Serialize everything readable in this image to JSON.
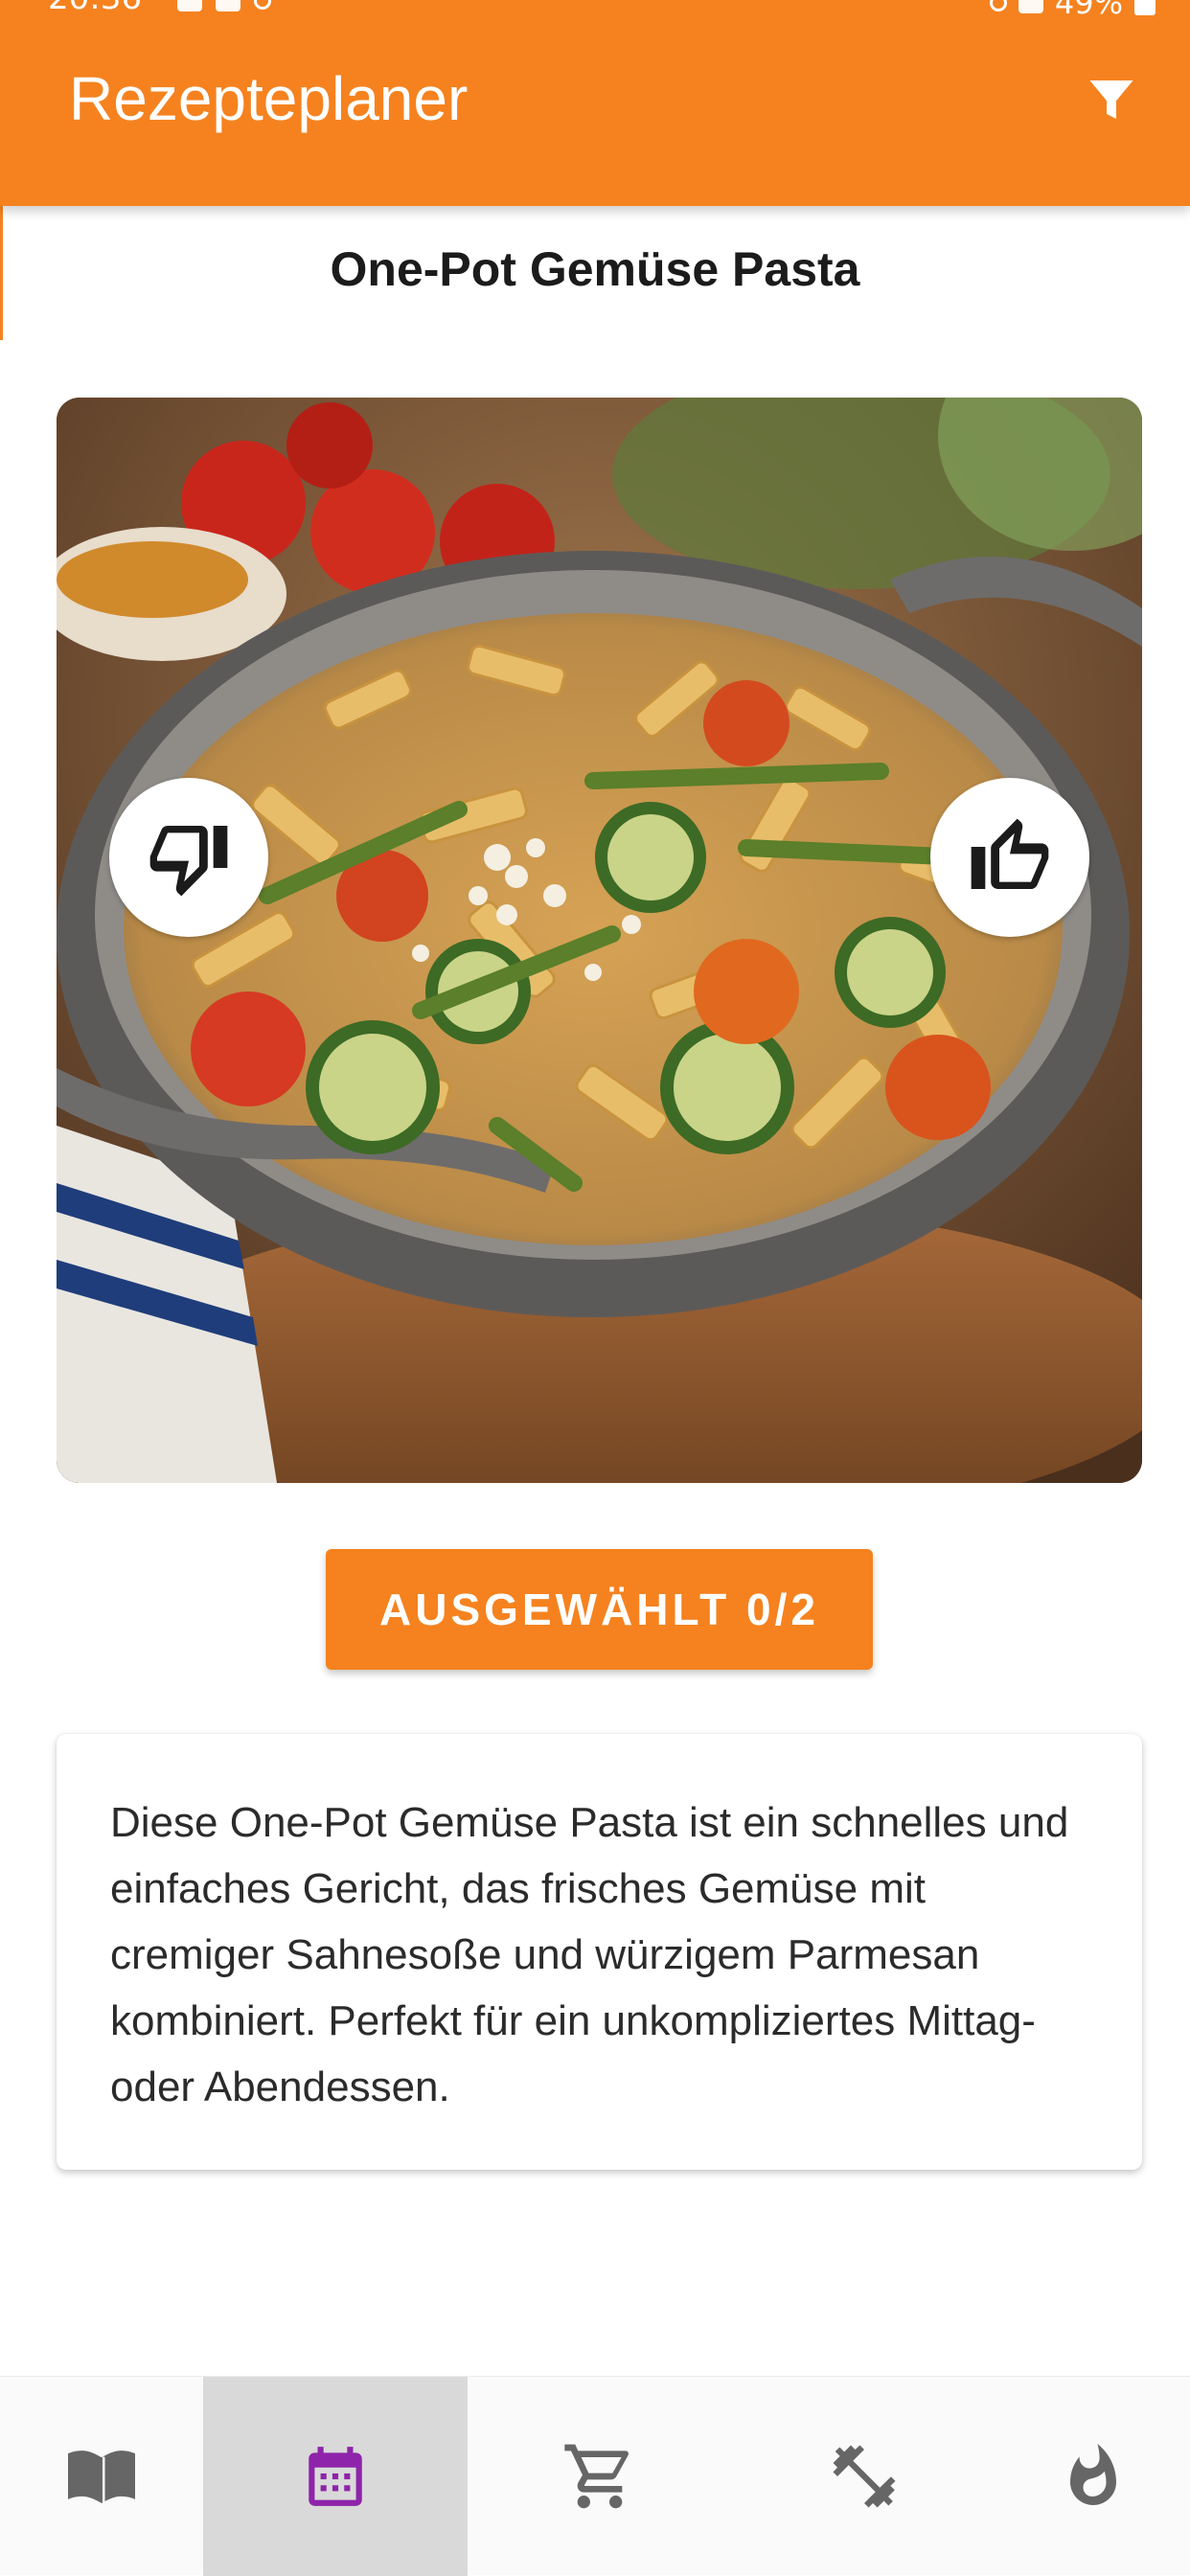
{
  "status_bar": {
    "time": "20:36",
    "battery": "49%"
  },
  "app_bar": {
    "title": "Rezepteplaner",
    "filter_icon": "filter-icon"
  },
  "recipe": {
    "title": "One-Pot Gemüse Pasta",
    "image_description_icon": "pasta-photo",
    "dislike_icon": "thumbs-down-icon",
    "like_icon": "thumbs-up-icon",
    "select_button_label": "AUSGEWÄHLT 0/2",
    "description": "Diese One-Pot Gemüse Pasta ist ein schnelles und einfaches Gericht, das frisches Gemüse mit cremiger Sahnesoße und würzigem Parmesan kombiniert. Perfekt für ein unkompliziertes Mittag- oder Abendessen."
  },
  "bottom_nav": {
    "items": [
      {
        "icon": "book-icon",
        "active": false
      },
      {
        "icon": "calendar-icon",
        "active": true
      },
      {
        "icon": "shopping-cart-icon",
        "active": false
      },
      {
        "icon": "fitness-icon",
        "active": false
      },
      {
        "icon": "fire-icon",
        "active": false
      }
    ]
  },
  "colors": {
    "primary": "#F5821F",
    "active_icon": "#8E24AA",
    "inactive_icon": "#666666",
    "active_tab_bg": "#D9D9D9"
  }
}
